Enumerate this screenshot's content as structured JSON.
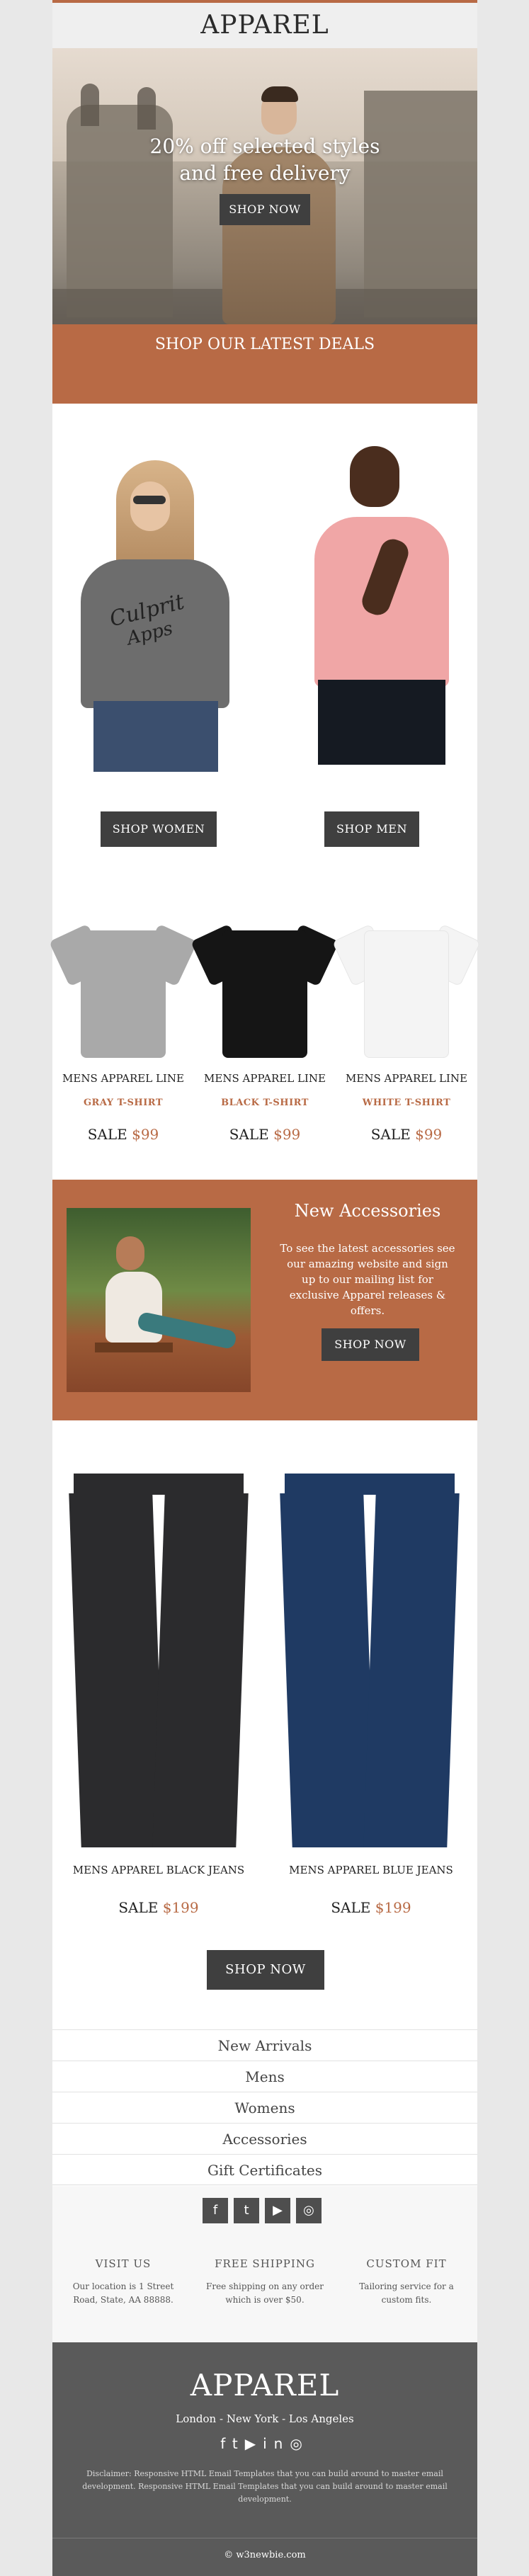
{
  "brand": "APPAREL",
  "hero": {
    "line1": "20% off selected styles",
    "line2": "and free delivery",
    "button": "SHOP NOW"
  },
  "deals": {
    "title": "SHOP OUR LATEST DEALS"
  },
  "models": {
    "women_button": "SHOP WOMEN",
    "men_button": "SHOP MEN",
    "print_line1": "Culprit",
    "print_line2": "Apps"
  },
  "tshirts": [
    {
      "name": "MENS APPAREL LINE",
      "variant": "GRAY T-SHIRT",
      "sale": "SALE",
      "price": "$99",
      "color": "#a9a9a9"
    },
    {
      "name": "MENS APPAREL LINE",
      "variant": "BLACK T-SHIRT",
      "sale": "SALE",
      "price": "$99",
      "color": "#151515"
    },
    {
      "name": "MENS APPAREL LINE",
      "variant": "WHITE T-SHIRT",
      "sale": "SALE",
      "price": "$99",
      "color": "#f4f4f4"
    }
  ],
  "accessories": {
    "title": "New Accessories",
    "body": "To see the latest accessories see our amazing website and sign up to our mailing list for exclusive Apparel releases & offers.",
    "button": "SHOP NOW"
  },
  "jeans": [
    {
      "name": "MENS APPAREL BLACK JEANS",
      "sale": "SALE",
      "price": "$199",
      "color": "#2b2b2d"
    },
    {
      "name": "MENS APPAREL BLUE JEANS",
      "sale": "SALE",
      "price": "$199",
      "color": "#1f3a63"
    }
  ],
  "jeans_button": "SHOP NOW",
  "nav": [
    "New Arrivals",
    "Mens",
    "Womens",
    "Accessories",
    "Gift Certificates"
  ],
  "social": [
    "facebook-icon",
    "twitter-icon",
    "youtube-icon",
    "instagram-icon"
  ],
  "info": [
    {
      "heading": "VISIT US",
      "text": "Our location is 1 Street Road, State, AA 88888."
    },
    {
      "heading": "FREE SHIPPING",
      "text": "Free shipping on any order which is over $50."
    },
    {
      "heading": "CUSTOM FIT",
      "text": "Tailoring service for a custom fits."
    }
  ],
  "footer": {
    "brand": "APPAREL",
    "cities": "London - New York - Los Angeles",
    "disclaimer": "Disclaimer: Responsive HTML Email Templates that you can build around to master email development. Responsive HTML Email Templates that you can build around to master email development.",
    "copyright": "© w3newbie.com"
  }
}
